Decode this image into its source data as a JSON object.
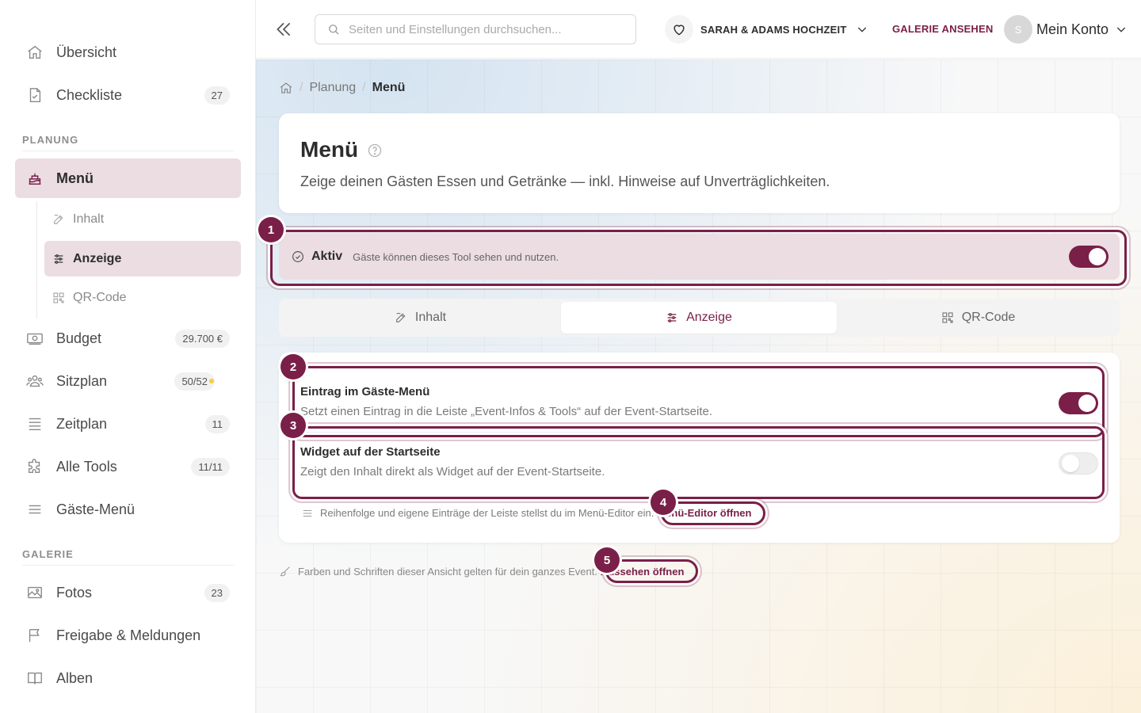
{
  "sidebar": {
    "items_top": [
      {
        "label": "Übersicht",
        "icon": "home-icon"
      },
      {
        "label": "Checkliste",
        "icon": "checklist-icon",
        "badge": "27"
      }
    ],
    "section_planung": "PLANUNG",
    "menu_item": {
      "label": "Menü",
      "icon": "cake-icon"
    },
    "sub_items": [
      {
        "label": "Inhalt",
        "icon": "edit-icon"
      },
      {
        "label": "Anzeige",
        "icon": "sliders-icon"
      },
      {
        "label": "QR-Code",
        "icon": "qr-code-icon"
      }
    ],
    "items_mid": [
      {
        "label": "Budget",
        "icon": "money-icon",
        "badge": "29.700 €"
      },
      {
        "label": "Sitzplan",
        "icon": "users-icon",
        "badge": "50/52"
      },
      {
        "label": "Zeitplan",
        "icon": "list-icon",
        "badge": "11"
      },
      {
        "label": "Alle Tools",
        "icon": "puzzle-icon",
        "badge": "11/11"
      },
      {
        "label": "Gäste-Menü",
        "icon": "menu-icon"
      }
    ],
    "section_galerie": "GALERIE",
    "items_gallery": [
      {
        "label": "Fotos",
        "icon": "image-icon",
        "badge": "23"
      },
      {
        "label": "Freigabe & Meldungen",
        "icon": "flag-icon"
      },
      {
        "label": "Alben",
        "icon": "book-icon"
      }
    ]
  },
  "topbar": {
    "search_placeholder": "Seiten und Einstellungen durchsuchen...",
    "event_name": "SARAH & ADAMS HOCHZEIT",
    "gallery_link": "GALERIE ANSEHEN",
    "avatar_initial": "S",
    "account_label": "Mein Konto"
  },
  "breadcrumb": {
    "parent": "Planung",
    "current": "Menü"
  },
  "page": {
    "title": "Menü",
    "description": "Zeige deinen Gästen Essen und Getränke — inkl. Hinweise auf Unverträglichkeiten."
  },
  "active_bar": {
    "title": "Aktiv",
    "description": "Gäste können dieses Tool sehen und nutzen.",
    "enabled": true
  },
  "tabs": [
    {
      "label": "Inhalt",
      "icon": "edit-icon"
    },
    {
      "label": "Anzeige",
      "icon": "sliders-icon",
      "active": true
    },
    {
      "label": "QR-Code",
      "icon": "qr-code-icon"
    }
  ],
  "settings": {
    "guest_menu_entry": {
      "title": "Eintrag im Gäste-Menü",
      "description": "Setzt einen Eintrag in die Leiste „Event-Infos & Tools“ auf der Event-Startseite.",
      "enabled": true
    },
    "home_widget": {
      "title": "Widget auf der Startseite",
      "description": "Zeigt den Inhalt direkt als Widget auf der Event-Startseite.",
      "enabled": false
    },
    "hint_text": "Reihenfolge und eigene Einträge der Leiste stellst du im Menü-Editor ein.",
    "hint_link": "Menü-Editor öffnen"
  },
  "footnote": {
    "text": "Farben und Schriften dieser Ansicht gelten für dein ganzes Event.",
    "link": "Aussehen öffnen"
  },
  "callouts": [
    "1",
    "2",
    "3",
    "4",
    "5"
  ],
  "colors": {
    "accent": "#7a1f48",
    "active_bg": "#ebdde2"
  }
}
